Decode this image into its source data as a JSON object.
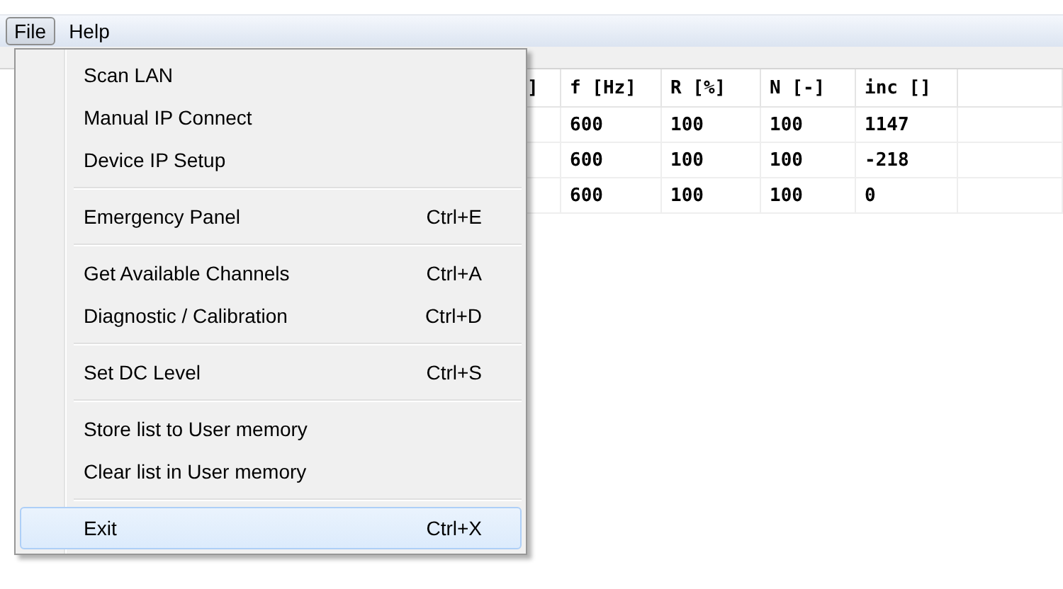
{
  "menubar": [
    {
      "label": "File",
      "selected": true
    },
    {
      "label": "Help",
      "selected": false
    }
  ],
  "table": {
    "columns": [
      "]",
      "f [Hz]",
      "R [%]",
      "N [-]",
      "inc []"
    ],
    "rows": [
      [
        "",
        "600",
        "100",
        "100",
        "1147"
      ],
      [
        "",
        "600",
        "100",
        "100",
        "-218"
      ],
      [
        "",
        "600",
        "100",
        "100",
        "0"
      ]
    ]
  },
  "menu": {
    "groups": [
      [
        {
          "label": "Scan LAN",
          "selected": false
        },
        {
          "label": "Manual IP Connect",
          "selected": false
        },
        {
          "label": "Device IP Setup",
          "selected": false
        }
      ],
      [
        {
          "label": "Emergency Panel",
          "shortcut": "Ctrl+E",
          "selected": false
        }
      ],
      [
        {
          "label": "Get Available Channels",
          "shortcut": "Ctrl+A",
          "selected": false
        },
        {
          "label": "Diagnostic / Calibration",
          "shortcut": "Ctrl+D",
          "selected": false
        }
      ],
      [
        {
          "label": "Set DC Level",
          "shortcut": "Ctrl+S",
          "selected": false
        }
      ],
      [
        {
          "label": "Store list to User memory",
          "selected": false
        },
        {
          "label": "Clear list in User memory",
          "selected": false
        }
      ],
      [
        {
          "label": "Exit",
          "shortcut": "Ctrl+X",
          "selected": true
        }
      ]
    ]
  }
}
